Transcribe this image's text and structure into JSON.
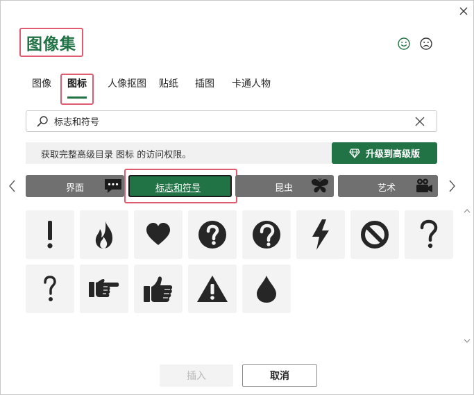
{
  "dialog": {
    "title": "图像集",
    "close_icon": "close-icon",
    "feedback": {
      "smile_icon": "smile-icon",
      "frown_icon": "frown-icon"
    }
  },
  "tabs": [
    {
      "label": "图像",
      "active": false
    },
    {
      "label": "图标",
      "active": true
    },
    {
      "label": "人像抠图",
      "active": false
    },
    {
      "label": "贴纸",
      "active": false
    },
    {
      "label": "插图",
      "active": false
    },
    {
      "label": "卡通人物",
      "active": false
    }
  ],
  "search": {
    "value": "标志和符号",
    "search_icon": "search-icon",
    "clear_icon": "clear-icon"
  },
  "promo": {
    "text": "获取完整高级目录 图标 的访问权限。",
    "upgrade_label": "升级到高级版",
    "upgrade_icon": "diamond-icon"
  },
  "categories": [
    {
      "label": "界面",
      "icon": "speech-bubble-icon",
      "active": false
    },
    {
      "label": "标志和符号",
      "icon": "",
      "active": true
    },
    {
      "label": "昆虫",
      "icon": "butterfly-icon",
      "active": false
    },
    {
      "label": "艺术",
      "icon": "movie-camera-icon",
      "active": false
    }
  ],
  "icons": [
    "exclamation-icon",
    "flame-icon",
    "heart-icon",
    "question-circle-icon",
    "question-keyhole-icon",
    "lightning-icon",
    "prohibited-icon",
    "question-mark-icon",
    "question-hook-icon",
    "pointing-hand-icon",
    "thumbs-up-icon",
    "warning-icon",
    "water-drop-icon"
  ],
  "buttons": {
    "insert_label": "插入",
    "cancel_label": "取消"
  },
  "colors": {
    "accent": "#217346",
    "category_gray": "#707070",
    "highlight": "#e05a70",
    "icon_fill": "#262626",
    "tile_bg": "#f3f3f3"
  }
}
